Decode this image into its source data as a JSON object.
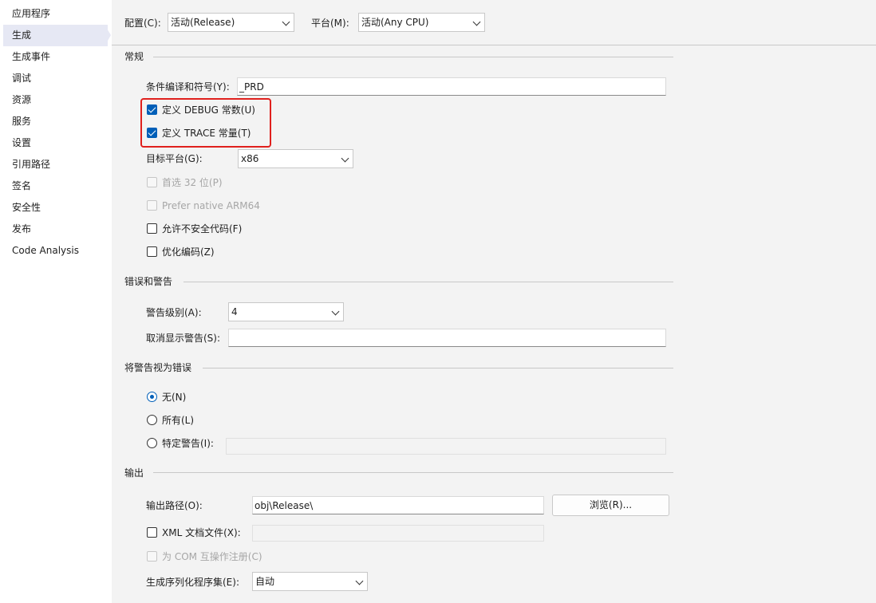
{
  "sidebar": {
    "items": [
      {
        "label": "应用程序"
      },
      {
        "label": "生成"
      },
      {
        "label": "生成事件"
      },
      {
        "label": "调试"
      },
      {
        "label": "资源"
      },
      {
        "label": "服务"
      },
      {
        "label": "设置"
      },
      {
        "label": "引用路径"
      },
      {
        "label": "签名"
      },
      {
        "label": "安全性"
      },
      {
        "label": "发布"
      },
      {
        "label": "Code Analysis"
      }
    ],
    "selected": "生成"
  },
  "toolbar": {
    "config_label": "配置(C):",
    "config_value": "活动(Release)",
    "platform_label": "平台(M):",
    "platform_value": "活动(Any CPU)"
  },
  "general": {
    "title": "常规",
    "symbols_label": "条件编译和符号(Y):",
    "symbols_value": "_PRD",
    "define_debug_label": "定义 DEBUG 常数(U)",
    "define_debug_checked": true,
    "define_trace_label": "定义 TRACE 常量(T)",
    "define_trace_checked": true,
    "target_label": "目标平台(G):",
    "target_value": "x86",
    "prefer32_label": "首选 32 位(P)",
    "prefer_arm_label": "Prefer native ARM64",
    "unsafe_label": "允许不安全代码(F)",
    "unsafe_checked": false,
    "optimize_label": "优化编码(Z)",
    "optimize_checked": false
  },
  "errors": {
    "title": "错误和警告",
    "warning_level_label": "警告级别(A):",
    "warning_level_value": "4",
    "suppress_label": "取消显示警告(S):",
    "suppress_value": ""
  },
  "treat": {
    "title": "将警告视为错误",
    "none_label": "无(N)",
    "all_label": "所有(L)",
    "specific_label": "特定警告(I):",
    "selected": "none"
  },
  "output": {
    "title": "输出",
    "path_label": "输出路径(O):",
    "path_value": "obj\\Release\\",
    "browse_label": "浏览(R)...",
    "xml_label": "XML 文档文件(X):",
    "xml_checked": false,
    "com_label": "为 COM 互操作注册(C)",
    "serialize_label": "生成序列化程序集(E):",
    "serialize_value": "自动"
  },
  "colors": {
    "accent": "#005fb8",
    "highlight_box": "#e0201d",
    "selected_nav": "#e6e8f4"
  }
}
